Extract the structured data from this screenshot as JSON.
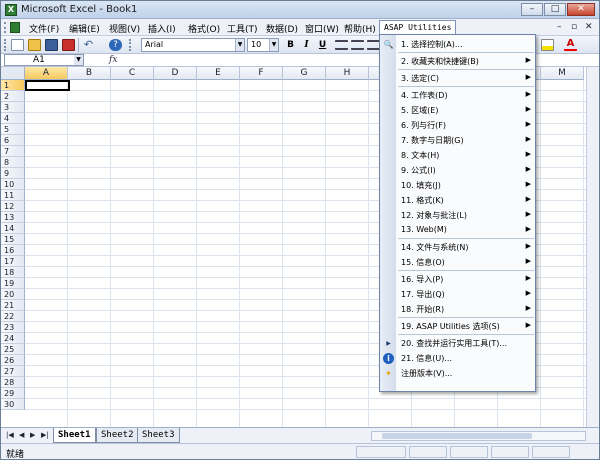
{
  "window": {
    "title": "Microsoft Excel - Book1",
    "app_icon": "X",
    "controls": [
      "–",
      "□",
      "✕"
    ]
  },
  "menubar": {
    "items": [
      "文件(F)",
      "编辑(E)",
      "视图(V)",
      "插入(I)",
      "格式(O)",
      "工具(T)",
      "数据(D)",
      "窗口(W)",
      "帮助(H)"
    ],
    "active": "ASAP Utilities",
    "mdi_controls": [
      "–",
      "▫",
      "✕"
    ]
  },
  "toolbar": {
    "font_name": "Arial",
    "font_size": "10",
    "bold": "B",
    "italic": "I",
    "underline": "U"
  },
  "formula_bar": {
    "name_box": "A1",
    "fx": "fx",
    "formula": ""
  },
  "grid": {
    "columns": [
      "A",
      "B",
      "C",
      "D",
      "E",
      "F",
      "G",
      "H",
      "I",
      "J",
      "K",
      "L",
      "M"
    ],
    "rows": [
      "1",
      "2",
      "3",
      "4",
      "5",
      "6",
      "7",
      "8",
      "9",
      "10",
      "11",
      "12",
      "13",
      "14",
      "15",
      "16",
      "17",
      "18",
      "19",
      "20",
      "21",
      "22",
      "23",
      "24",
      "25",
      "26",
      "27",
      "28",
      "29",
      "30"
    ],
    "selected_cell": "A1"
  },
  "dropdown": {
    "items": [
      {
        "label": "1. 选择控制(A)...",
        "arrow": "",
        "icon": "magnifier-icon"
      },
      {
        "label": "2. 收藏夹和快捷键(B)",
        "arrow": "▶",
        "icon": ""
      },
      {
        "label": "3. 选定(C)",
        "arrow": "▶",
        "icon": ""
      },
      {
        "label": "4. 工作表(D)",
        "arrow": "▶",
        "icon": ""
      },
      {
        "label": "5. 区域(E)",
        "arrow": "▶",
        "icon": ""
      },
      {
        "label": "6. 列与行(F)",
        "arrow": "▶",
        "icon": ""
      },
      {
        "label": "7. 数字与日期(G)",
        "arrow": "▶",
        "icon": ""
      },
      {
        "label": "8. 文本(H)",
        "arrow": "▶",
        "icon": ""
      },
      {
        "label": "9. 公式(I)",
        "arrow": "▶",
        "icon": ""
      },
      {
        "label": "10. 填充(J)",
        "arrow": "▶",
        "icon": ""
      },
      {
        "label": "11. 格式(K)",
        "arrow": "▶",
        "icon": ""
      },
      {
        "label": "12. 对象与批注(L)",
        "arrow": "▶",
        "icon": ""
      },
      {
        "label": "13. Web(M)",
        "arrow": "▶",
        "icon": ""
      },
      {
        "label": "14. 文件与系统(N)",
        "arrow": "▶",
        "icon": ""
      },
      {
        "label": "15. 信息(O)",
        "arrow": "▶",
        "icon": ""
      },
      {
        "label": "16. 导入(P)",
        "arrow": "▶",
        "icon": ""
      },
      {
        "label": "17. 导出(Q)",
        "arrow": "▶",
        "icon": ""
      },
      {
        "label": "18. 开始(R)",
        "arrow": "▶",
        "icon": ""
      },
      {
        "label": "19. ASAP Utilities 选项(S)",
        "arrow": "▶",
        "icon": ""
      },
      {
        "label": "20. 查找并运行实用工具(T)...",
        "arrow": "",
        "icon": "play-icon"
      },
      {
        "label": "21. 信息(U)...",
        "arrow": "",
        "icon": "info-icon"
      },
      {
        "label": "注册版本(V)...",
        "arrow": "",
        "icon": "lightbulb-icon"
      }
    ]
  },
  "sheets": {
    "tabs": [
      "Sheet1",
      "Sheet2",
      "Sheet3"
    ],
    "active": "Sheet1",
    "nav": [
      "|◀",
      "◀",
      "▶",
      "▶|"
    ]
  },
  "status": {
    "text": "就绪"
  },
  "colors": {
    "selection_header": "#f7c85e",
    "menu_highlight": "#cfe0f6",
    "excel_green": "#2f7d32"
  }
}
